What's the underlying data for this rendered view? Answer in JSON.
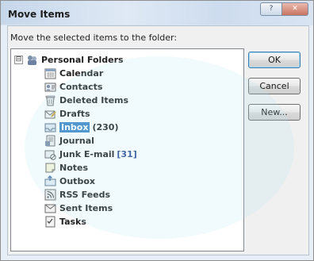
{
  "window": {
    "title": "Move Items"
  },
  "titlebar_buttons": {
    "help": "?",
    "close": "✕"
  },
  "prompt": "Move the selected items to the folder:",
  "tree": {
    "root": {
      "label": "Personal Folders",
      "expander": "⊟",
      "icon": "personal-folders-icon"
    },
    "items": [
      {
        "label": "Calendar",
        "icon": "calendar-icon",
        "count": ""
      },
      {
        "label": "Contacts",
        "icon": "contacts-icon",
        "count": ""
      },
      {
        "label": "Deleted Items",
        "icon": "deleted-items-icon",
        "count": ""
      },
      {
        "label": "Drafts",
        "icon": "drafts-icon",
        "count": ""
      },
      {
        "label": "Inbox",
        "icon": "inbox-icon",
        "count": "(230)",
        "selected": true
      },
      {
        "label": "Journal",
        "icon": "journal-icon",
        "count": ""
      },
      {
        "label": "Junk E-mail",
        "icon": "junk-email-icon",
        "count": "[31]"
      },
      {
        "label": "Notes",
        "icon": "notes-icon",
        "count": ""
      },
      {
        "label": "Outbox",
        "icon": "outbox-icon",
        "count": ""
      },
      {
        "label": "RSS Feeds",
        "icon": "rss-feeds-icon",
        "count": ""
      },
      {
        "label": "Sent Items",
        "icon": "sent-items-icon",
        "count": ""
      },
      {
        "label": "Tasks",
        "icon": "tasks-icon",
        "count": ""
      }
    ]
  },
  "buttons": {
    "ok": "OK",
    "cancel": "Cancel",
    "new": "New..."
  },
  "colors": {
    "selection": "#3f87c9",
    "titlebar": "#cddcee",
    "junk_count": "#2a4f96"
  }
}
